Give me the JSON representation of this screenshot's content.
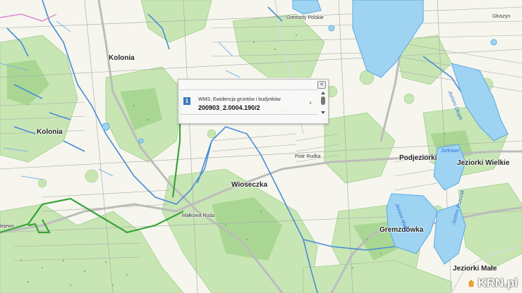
{
  "map": {
    "places": [
      {
        "id": "kolonia-n",
        "name": "Kolonia",
        "size": "normal"
      },
      {
        "id": "kolonia-w",
        "name": "Kolonia",
        "size": "normal"
      },
      {
        "id": "gremzdy-polskie",
        "name": "Gremzdy Polskie",
        "size": "small"
      },
      {
        "id": "gluszyn",
        "name": "Głuszyn",
        "size": "small"
      },
      {
        "id": "podjeziorki",
        "name": "Podjeziorki",
        "size": "normal"
      },
      {
        "id": "jeziorki-wielkie",
        "name": "Jeziorki Wielkie",
        "size": "normal"
      },
      {
        "id": "wioseczka",
        "name": "Wioseczka",
        "size": "normal"
      },
      {
        "id": "gremzdowka",
        "name": "Gremzdówka",
        "size": "normal"
      },
      {
        "id": "jeziorki-male",
        "name": "Jeziorki Małe",
        "size": "normal"
      },
      {
        "id": "malkowa-ruda",
        "name": "Małkowa Ruda",
        "size": "small"
      },
      {
        "id": "piotr-rudka",
        "name": "Piotr Rudka",
        "size": "small"
      },
      {
        "id": "glejewo",
        "name": "lejewo",
        "size": "small"
      }
    ],
    "water_labels": [
      {
        "id": "jurkowo",
        "name": "Jurkowo"
      },
      {
        "id": "jezioro-dlugie",
        "name": "Jezioro Długie"
      },
      {
        "id": "jezioro-malke",
        "name": "Jezioro Małke"
      },
      {
        "id": "jezioro-puszcza",
        "name": "Jezioro Pszczak"
      }
    ],
    "colors": {
      "background": "#f6f6ee",
      "forest": "#c8e6b4",
      "forest_dark": "#a9d793",
      "water": "#9fd3f2",
      "river": "#4a8bd6",
      "parcel": "#9b9b9b",
      "road": "#b3b3b3",
      "boundary": "#3aa33a"
    }
  },
  "popup": {
    "layer_title": "WMS, Ewidencja gruntów i budynków",
    "parcel_id": "200903_2.0004.190/2",
    "close_icon": "close-icon",
    "info_icon": "info-icon"
  },
  "watermark": {
    "text": "KRN.pl",
    "icon": "home-icon"
  }
}
